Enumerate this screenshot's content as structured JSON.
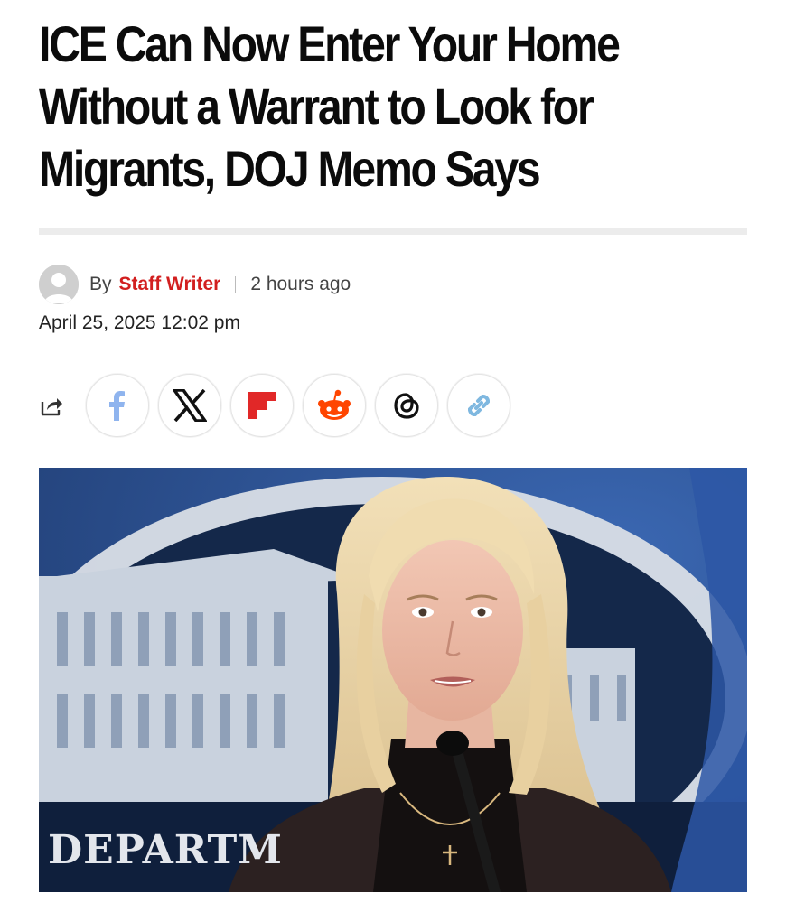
{
  "article": {
    "headline_lines": [
      "ICE Can Now Enter Your Home",
      "Without a Warrant to Look for",
      "Migrants, DOJ Memo Says"
    ],
    "byline_prefix": "By",
    "author": "Staff Writer",
    "time_ago": "2 hours ago",
    "published": "April 25, 2025 12:02 pm"
  },
  "share": {
    "icons": [
      "share-icon",
      "facebook-icon",
      "x-icon",
      "flipboard-icon",
      "reddit-icon",
      "threads-icon",
      "copy-link-icon"
    ]
  },
  "hero_image": {
    "sign_text": "DEPARTM"
  },
  "colors": {
    "author": "#d21f1f",
    "facebook": "#1877f2",
    "flipboard": "#e12828",
    "reddit": "#ff4500",
    "link": "#5aa7d8"
  }
}
